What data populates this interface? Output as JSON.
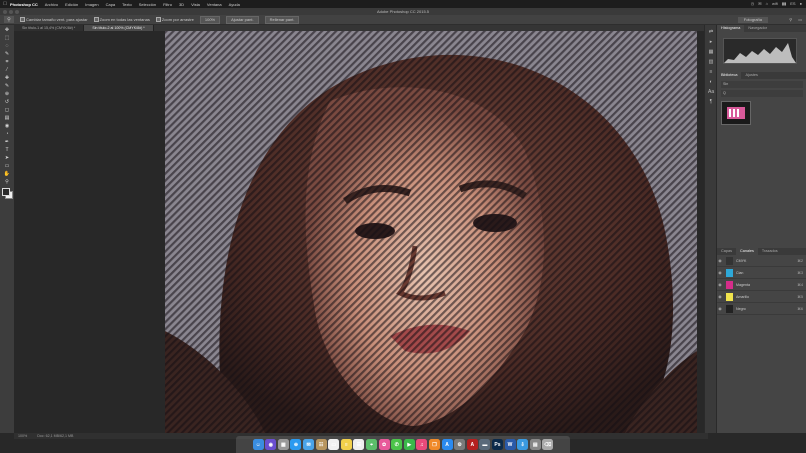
{
  "menubar": {
    "apple": "",
    "app": "Photoshop CC",
    "items": [
      "Archivo",
      "Edición",
      "Imagen",
      "Capa",
      "Texto",
      "Selección",
      "Filtro",
      "3D",
      "Vista",
      "Ventana",
      "Ayuda"
    ],
    "status": [
      "◷",
      "✉",
      "⌂",
      "wifi",
      "▮▮",
      "ES",
      "●"
    ]
  },
  "window": {
    "title": "Adobe Photoshop CC 2015.5"
  },
  "options_bar": {
    "tool_icon": "zoom-icon",
    "options": [
      "Cambiar tamaño vent. para ajustar",
      "Zoom en todas las ventanas",
      "Zoom por arrastre"
    ],
    "buttons": [
      "100%",
      "Ajustar pant.",
      "Rellenar pant."
    ],
    "workspace": "Fotografía"
  },
  "tabs": [
    {
      "label": "Sin título-1 al 15,4% (CMYK/8#) *",
      "active": false
    },
    {
      "label": "Sin título-2 al 100% (CMYK/8#) *",
      "active": true
    }
  ],
  "toolbar_tools": [
    "move-icon",
    "marquee-icon",
    "lasso-icon",
    "quick-select-icon",
    "crop-icon",
    "eyedropper-icon",
    "healing-icon",
    "brush-icon",
    "stamp-icon",
    "history-brush-icon",
    "eraser-icon",
    "gradient-icon",
    "blur-icon",
    "dodge-icon",
    "pen-icon",
    "type-icon",
    "path-select-icon",
    "shape-icon",
    "hand-icon",
    "zoom-icon"
  ],
  "toolbar_glyphs": [
    "✥",
    "⬚",
    "◌",
    "✎",
    "⌗",
    "⁄",
    "✚",
    "✎",
    "⊕",
    "↺",
    "◻",
    "▤",
    "◉",
    "◔",
    "✒",
    "T",
    "➤",
    "▭",
    "✋",
    "⚲"
  ],
  "right_icons": [
    "⇄",
    "▸",
    "▦",
    "▥",
    "≡",
    "◐",
    "Aa",
    "¶"
  ],
  "panels": {
    "top_tabs": [
      "Histograma",
      "Navegador"
    ],
    "mid_tabs": [
      "Biblioteca",
      "Ajustes"
    ],
    "library_rows": [
      "Sin",
      "Q"
    ],
    "bottom_tabs": [
      "Capas",
      "Canales",
      "Trazados"
    ],
    "active_bottom_tab": "Canales",
    "channels": [
      {
        "name": "CMYK",
        "shortcut": "⌘2",
        "color": "#333333"
      },
      {
        "name": "Cian",
        "shortcut": "⌘3",
        "color": "#2ea8d8"
      },
      {
        "name": "Magenta",
        "shortcut": "⌘4",
        "color": "#d62d8a"
      },
      {
        "name": "Amarillo",
        "shortcut": "⌘5",
        "color": "#f1e44d"
      },
      {
        "name": "Negro",
        "shortcut": "⌘6",
        "color": "#222222"
      }
    ]
  },
  "status_bar": {
    "zoom": "100%",
    "doc": "Doc: 62,1 MB/62,1 MB"
  },
  "dock": [
    {
      "name": "finder-icon",
      "color": "#3a8de0",
      "glyph": "☺"
    },
    {
      "name": "siri-icon",
      "color": "#6a4fd0",
      "glyph": "◉"
    },
    {
      "name": "launchpad-icon",
      "color": "#999999",
      "glyph": "▦"
    },
    {
      "name": "safari-icon",
      "color": "#2b9af0",
      "glyph": "⊕"
    },
    {
      "name": "mail-icon",
      "color": "#4aa3e8",
      "glyph": "✉"
    },
    {
      "name": "contacts-icon",
      "color": "#b8965f",
      "glyph": "☷"
    },
    {
      "name": "calendar-icon",
      "color": "#f0f0f0",
      "glyph": "▭"
    },
    {
      "name": "notes-icon",
      "color": "#f2d04b",
      "glyph": "≡"
    },
    {
      "name": "reminders-icon",
      "color": "#eeeeee",
      "glyph": "☰"
    },
    {
      "name": "maps-icon",
      "color": "#5cbf6a",
      "glyph": "⌖"
    },
    {
      "name": "photos-icon",
      "color": "#e85a9a",
      "glyph": "✿"
    },
    {
      "name": "messages-icon",
      "color": "#4cc44a",
      "glyph": "✆"
    },
    {
      "name": "facetime-icon",
      "color": "#3ab84a",
      "glyph": "▶"
    },
    {
      "name": "itunes-icon",
      "color": "#e94a7a",
      "glyph": "♫"
    },
    {
      "name": "ibooks-icon",
      "color": "#f08a2a",
      "glyph": "❐"
    },
    {
      "name": "appstore-icon",
      "color": "#2a8af0",
      "glyph": "A"
    },
    {
      "name": "preferences-icon",
      "color": "#7a7a7a",
      "glyph": "⚙"
    },
    {
      "name": "acrobat-icon",
      "color": "#b52020",
      "glyph": "A"
    },
    {
      "name": "folder-icon",
      "color": "#5a6a7a",
      "glyph": "▬"
    },
    {
      "name": "photoshop-icon",
      "color": "#0c2a4a",
      "glyph": "Ps"
    },
    {
      "name": "word-icon",
      "color": "#2a5aa8",
      "glyph": "W"
    },
    {
      "name": "downloads-icon",
      "color": "#3a9ae0",
      "glyph": "⇩"
    },
    {
      "name": "folder2-icon",
      "color": "#888888",
      "glyph": "▤"
    },
    {
      "name": "trash-icon",
      "color": "#aaaaaa",
      "glyph": "⌫"
    }
  ]
}
